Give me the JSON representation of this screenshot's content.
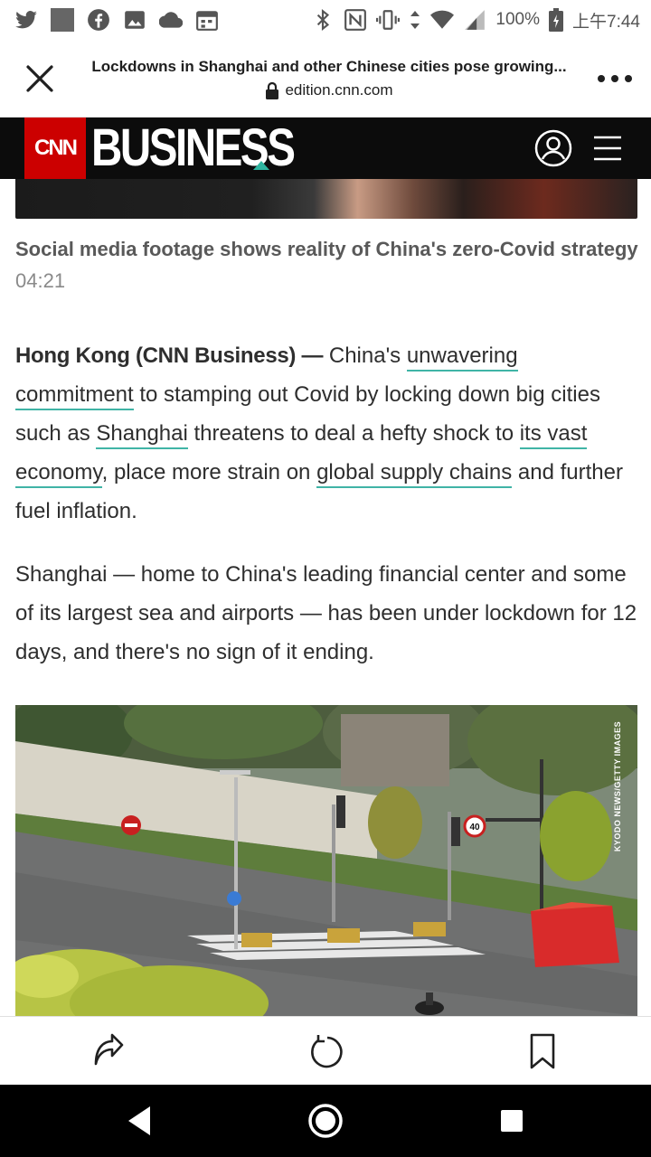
{
  "status_bar": {
    "icons": [
      "twitter-icon",
      "gray-square-icon",
      "facebook-icon",
      "image-icon",
      "cloud-icon",
      "calendar-icon",
      "bluetooth-icon",
      "nfc-icon",
      "vibrate-icon",
      "data-arrows-icon",
      "wifi-icon",
      "signal-icon",
      "battery-icon"
    ],
    "battery": "100%",
    "time": "上午7:44"
  },
  "tab_bar": {
    "title": "Lockdowns in Shanghai and other Chinese cities pose growing...",
    "url": "edition.cnn.com"
  },
  "cnn_header": {
    "logo": "CNN",
    "section": "BUSINESS"
  },
  "video": {
    "caption": "Social media footage shows reality of China's zero-Covid strategy",
    "duration": "04:21"
  },
  "article": {
    "p1": {
      "dateline": "Hong Kong (CNN Business) —",
      "t1": " China's ",
      "link1": "unwavering commitment",
      "t2": " to stamping out Covid by locking down big cities such as ",
      "link2": "Shanghai",
      "t3": " threatens to deal a hefty shock to ",
      "link3": "its vast economy",
      "t4": ", place more strain on ",
      "link4": "global supply chains",
      "t5": " and further fuel inflation."
    },
    "p2": "Shanghai — home to China's leading financial center and some of its largest sea and airports — has been under lockdown for 12 days, and there's no sign of it ending.",
    "photo_credit": "KYODO NEWS/GETTY IMAGES",
    "photo_signs": {
      "speed_limit": "40"
    }
  },
  "toolbar": {
    "items": [
      "share-icon",
      "reload-icon",
      "bookmark-icon"
    ]
  },
  "colors": {
    "cnn_red": "#cc0000",
    "header_bg": "#0c0c0c",
    "link_underline": "#40b4a6",
    "accent_triangle": "#2fb5a0"
  }
}
